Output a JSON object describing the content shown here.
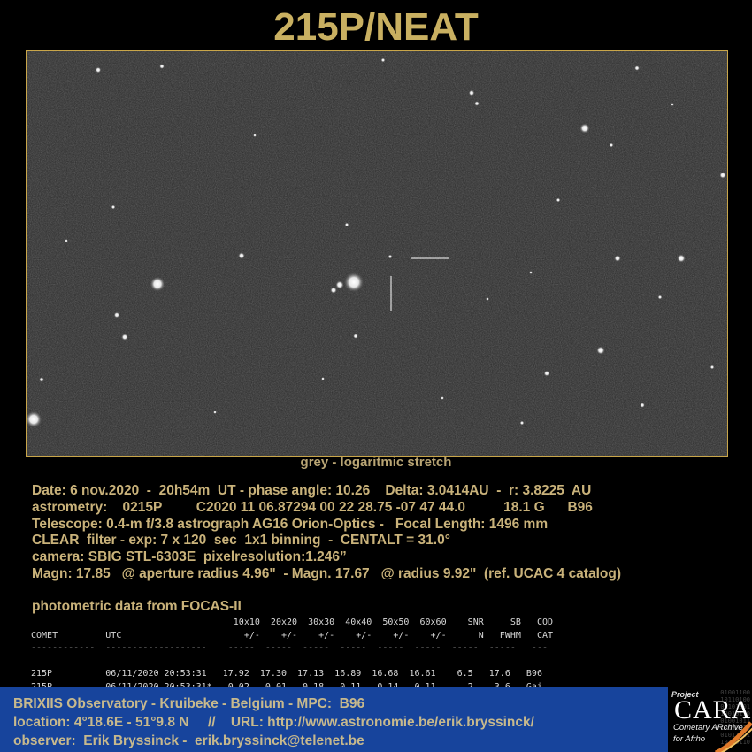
{
  "title": "215P/NEAT",
  "caption": "grey -  logaritmic stretch",
  "info_lines": [
    "Date: 6 nov.2020  -  20h54m  UT - phase angle: 10.26    Delta: 3.0414AU  -  r: 3.8225  AU",
    "astrometry:    0215P         C2020 11 06.87294 00 22 28.75 -07 47 44.0          18.1 G      B96",
    "Telescope: 0.4-m f/3.8 astrograph AG16 Orion-Optics -   Focal Length: 1496 mm",
    "CLEAR  filter - exp: 7 x 120  sec  1x1 binning  -  CENTALT = 31.0°",
    "camera: SBIG STL-6303E  pixelresolution:1.246”",
    "Magn: 17.85   @ aperture radius 4.96\"  - Magn. 17.67   @ radius 9.92\"  (ref. UCAC 4 catalog)"
  ],
  "photometry": {
    "heading": "photometric data from FOCAS-II",
    "lines": [
      "                                      10x10  20x20  30x30  40x40  50x50  60x60    SNR     SB   COD",
      "COMET         UTC                       +/-    +/-    +/-    +/-    +/-    +/-      N   FWHM   CAT",
      "------------  -------------------    -----  -----  -----  -----  -----  -----  -----  -----   ---",
      "",
      "215P          06/11/2020 20:53:31   17.92  17.30  17.13  16.89  16.68  16.61    6.5   17.6   B96",
      "215P          06/11/2020 20:53:31*   0.02   0.01   0.18   0.11   0.14   0.11      2    3.6   Gai"
    ]
  },
  "footer": {
    "line1": "BRIXIIS Observatory - Kruibeke - Belgium - MPC:  B96",
    "line2": "location: 4°18.6E - 51°9.8 N     //    URL: http://www.astronomie.be/erik.bryssinck/",
    "line3": "observer:  Erik Bryssinck -  erik.bryssinck@telenet.be"
  },
  "logo": {
    "project": "Project",
    "name": "CARA",
    "line1": "Cometary ARchive",
    "line2": "for Afrho",
    "bits": "01001100\n10110100\n01101001\n10010110\n01001011\n10110010\n01011001\n10100110"
  },
  "colors": {
    "title": "#c9b061",
    "text": "#c9b27a",
    "footer_bg": "#17449c",
    "frame_border": "#c9a64a",
    "sky": "#2a2a2a"
  }
}
